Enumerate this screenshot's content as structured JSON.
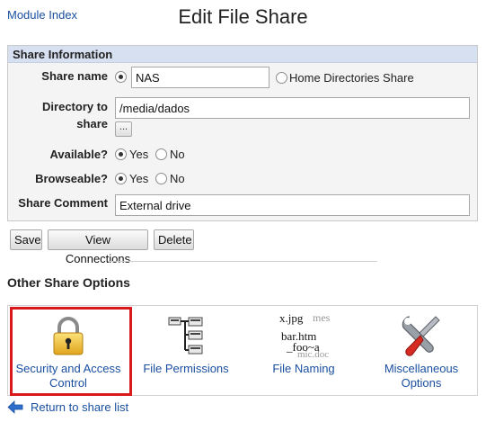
{
  "header": {
    "module_index": "Module Index",
    "title": "Edit File Share"
  },
  "share_info": {
    "section_title": "Share Information",
    "share_name_label": "Share name",
    "share_name_value": "NAS",
    "home_dirs_label": "Home Directories Share",
    "directory_label_line1": "Directory to",
    "directory_label_line2": "share",
    "directory_value": "/media/dados",
    "directory_chooser": "...",
    "available_label": "Available?",
    "browseable_label": "Browseable?",
    "yes": "Yes",
    "no": "No",
    "comment_label": "Share Comment",
    "comment_value": "External drive"
  },
  "buttons": {
    "save": "Save",
    "view_connections": "View Connections",
    "delete": "Delete"
  },
  "other_options": {
    "title": "Other Share Options",
    "items": [
      {
        "label_line1": "Security and Access",
        "label_line2": "Control",
        "icon": "padlock-icon"
      },
      {
        "label_line1": "File Permissions",
        "label_line2": "",
        "icon": "folder-tree-icon"
      },
      {
        "label_line1": "File Naming",
        "label_line2": "",
        "icon": "file-naming-icon"
      },
      {
        "label_line1": "Miscellaneous",
        "label_line2": "Options",
        "icon": "tools-icon"
      }
    ],
    "naming_icon_text": {
      "l1": "x.jpg",
      "l1b": "mes",
      "l2": "bar.htm",
      "l3": "_foo~a",
      "l4": "mic.doc"
    }
  },
  "footer": {
    "return_link": "Return to share list"
  },
  "colors": {
    "link": "#1a4fa0",
    "section_header_bg": "#d6e0f0",
    "highlight": "#d9191b"
  }
}
